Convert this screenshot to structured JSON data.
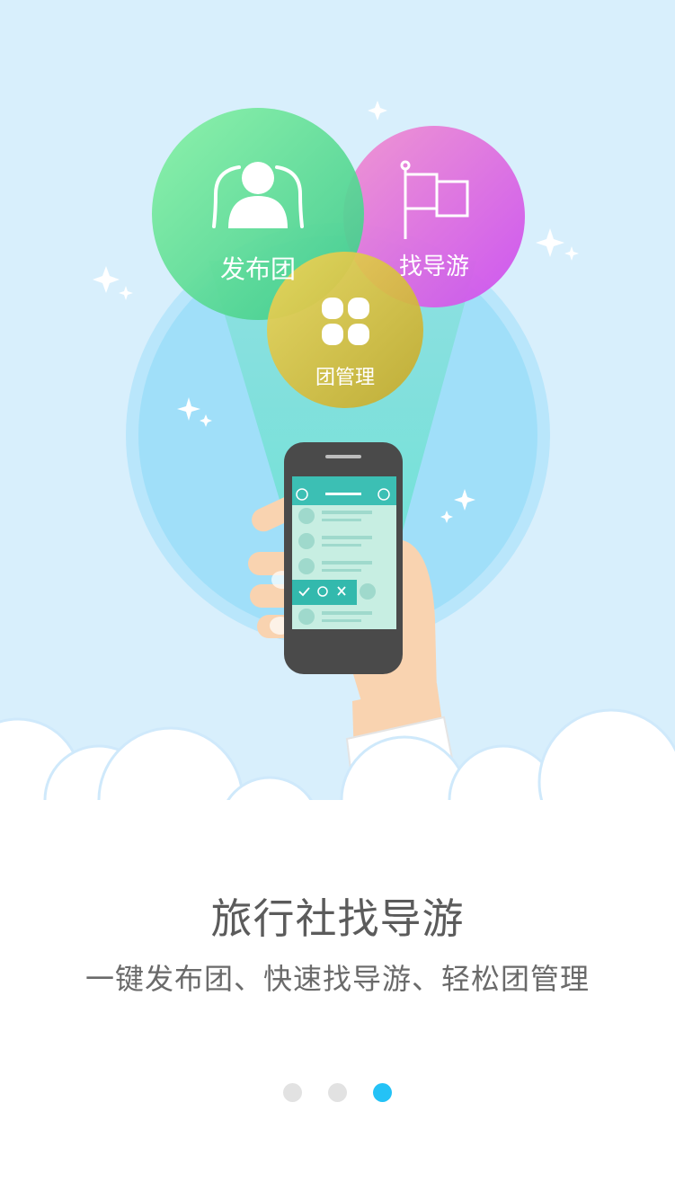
{
  "feature_circles": [
    {
      "label": "发布团",
      "icon": "users-icon",
      "color": "#5ed98c"
    },
    {
      "label": "找导游",
      "icon": "flag-icon",
      "color": "#e36fd9"
    },
    {
      "label": "团管理",
      "icon": "clover-icon",
      "color": "#d9c23d"
    }
  ],
  "headline": "旅行社找导游",
  "subtitle": "一键发布团、快速找导游、轻松团管理",
  "pagination": {
    "total": 3,
    "active_index": 2,
    "active_color": "#24c2f6"
  },
  "colors": {
    "sky": "#d8effc",
    "beam": "#7fdcd8",
    "halo": "#a4e0f9"
  }
}
